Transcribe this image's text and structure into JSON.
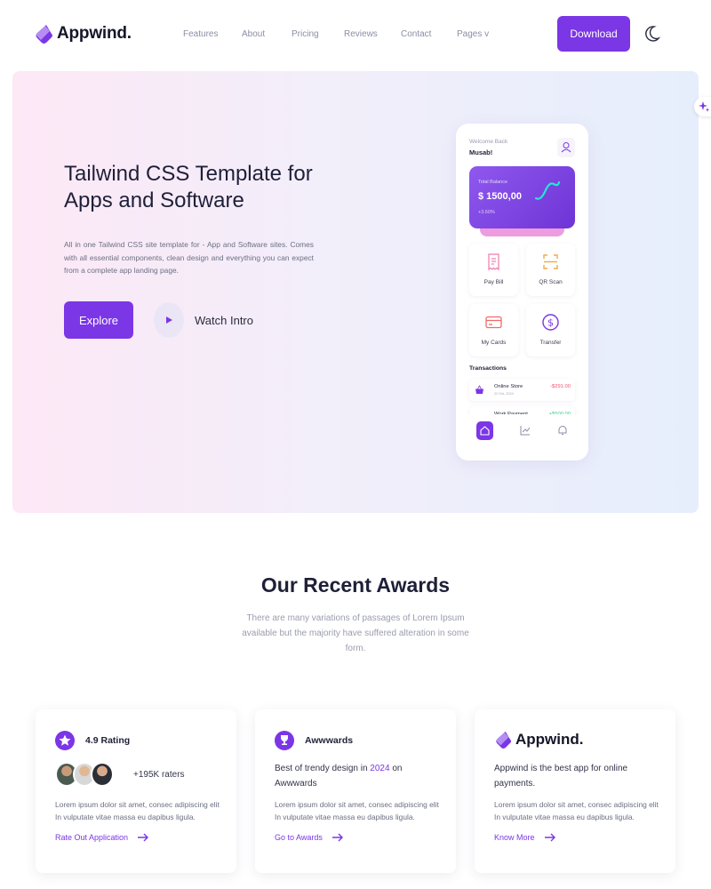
{
  "brand": {
    "name": "Appwind."
  },
  "nav": {
    "links": [
      "Features",
      "About",
      "Pricing",
      "Reviews",
      "Contact",
      "Pages v"
    ],
    "download_label": "Download"
  },
  "hero": {
    "title_line1": "Tailwind CSS Template for",
    "title_line2": "Apps and Software",
    "description": "All in one Tailwind CSS site template for - App and Software sites. Comes with all essential components, clean design and everything you can expect from a complete app landing page.",
    "explore_label": "Explore",
    "watch_label": "Watch Intro"
  },
  "phone": {
    "welcome": "Welcome Back",
    "name": "Musab!",
    "balance_label": "Total Balance",
    "balance": "$ 1500,00",
    "change": "+3.60%",
    "tiles": [
      "Pay Bill",
      "QR Scan",
      "My Cards",
      "Transfer"
    ],
    "transactions_title": "Transactions",
    "transactions": [
      {
        "name": "Online Store",
        "date": "22 Oct, 2024",
        "amount": "-$291.00"
      },
      {
        "name": "Work Payment",
        "date": "",
        "amount": "+$500.00"
      }
    ]
  },
  "awards": {
    "title": "Our Recent Awards",
    "subtitle": "There are many variations of passages of Lorem Ipsum available but the majority have suffered alteration in some form.",
    "cards": [
      {
        "heading": "4.9 Rating",
        "raters": "+195K raters",
        "body": "Lorem ipsum dolor sit amet, consec adipiscing elit In vulputate vitae massa eu dapibus ligula.",
        "link": "Rate Out Application"
      },
      {
        "heading": "Awwwards",
        "main_pre": "Best of trendy design in ",
        "main_year": "2024",
        "main_post": " on Awwwards",
        "body": "Lorem ipsum dolor sit amet, consec adipiscing elit In vulputate vitae massa eu dapibus ligula.",
        "link": "Go to Awards"
      },
      {
        "heading": "Appwind.",
        "main": "Appwind is the best app for online payments.",
        "body": "Lorem ipsum dolor sit amet, consec adipiscing elit In vulputate vitae massa eu dapibus ligula.",
        "link": "Know More"
      }
    ]
  },
  "colors": {
    "accent": "#7b36e6",
    "negative": "#f0506e",
    "positive": "#3cc98f"
  }
}
